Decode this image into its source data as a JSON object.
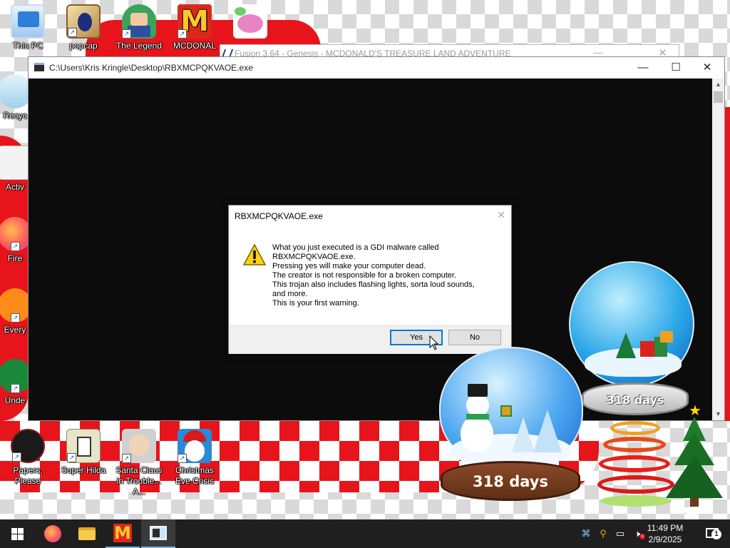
{
  "desktop": {
    "icons_top": [
      {
        "name": "this-pc",
        "label": "This PC"
      },
      {
        "name": "popcap",
        "label": "popcap"
      },
      {
        "name": "the-legend",
        "label": "The Legend"
      },
      {
        "name": "mcdonal-treasure",
        "label": "MCDONAL"
      }
    ],
    "icons_left_partial": [
      {
        "name": "recycle-bin",
        "label": "Recyc"
      },
      {
        "name": "acti",
        "label": "Activ"
      },
      {
        "name": "firefox",
        "label": "Fire"
      },
      {
        "name": "every",
        "label": "Every"
      },
      {
        "name": "unde",
        "label": "Unde"
      }
    ],
    "icons_bottom": [
      {
        "name": "papers-please",
        "label": "Papers, Please"
      },
      {
        "name": "super-hilda",
        "label": "Super Hilda"
      },
      {
        "name": "santa-claus-in-trouble",
        "label": "Santa Claus in Trouble... A..."
      },
      {
        "name": "christmas-eve-crisis",
        "label": "Christmas Eve Crisis"
      }
    ]
  },
  "background_window": {
    "title": "Fusion 3.64 - Genesis - MCDONALD'S    TREASURE LAND   ADVENTURE"
  },
  "console": {
    "title": "C:\\Users\\Kris Kringle\\Desktop\\RBXMCPQKVAOE.exe",
    "minimize": "—",
    "maximize": "☐",
    "close": "✕"
  },
  "dialog": {
    "title": "RBXMCPQKVAOE.exe",
    "close": "✕",
    "message_lines": [
      "What you just executed is a GDI malware called",
      "RBXMCPQKVAOE.exe.",
      "Pressing yes will make your computer dead.",
      "The creator is not responsible for a broken computer.",
      "This trojan also includes flashing lights, sorta loud sounds,",
      "and more.",
      "This is your first warning."
    ],
    "yes_label": "Yes",
    "no_label": "No"
  },
  "decorations": {
    "globe_small_label": "318 days",
    "globe_large_label": "318 days"
  },
  "taskbar": {
    "clock_time": "11:49 PM",
    "clock_date": "2/9/2025",
    "notification_count": "1"
  },
  "colors": {
    "wallpaper_red": "#e8141b",
    "taskbar": "#1f1f1f",
    "accent": "#0078d7"
  }
}
